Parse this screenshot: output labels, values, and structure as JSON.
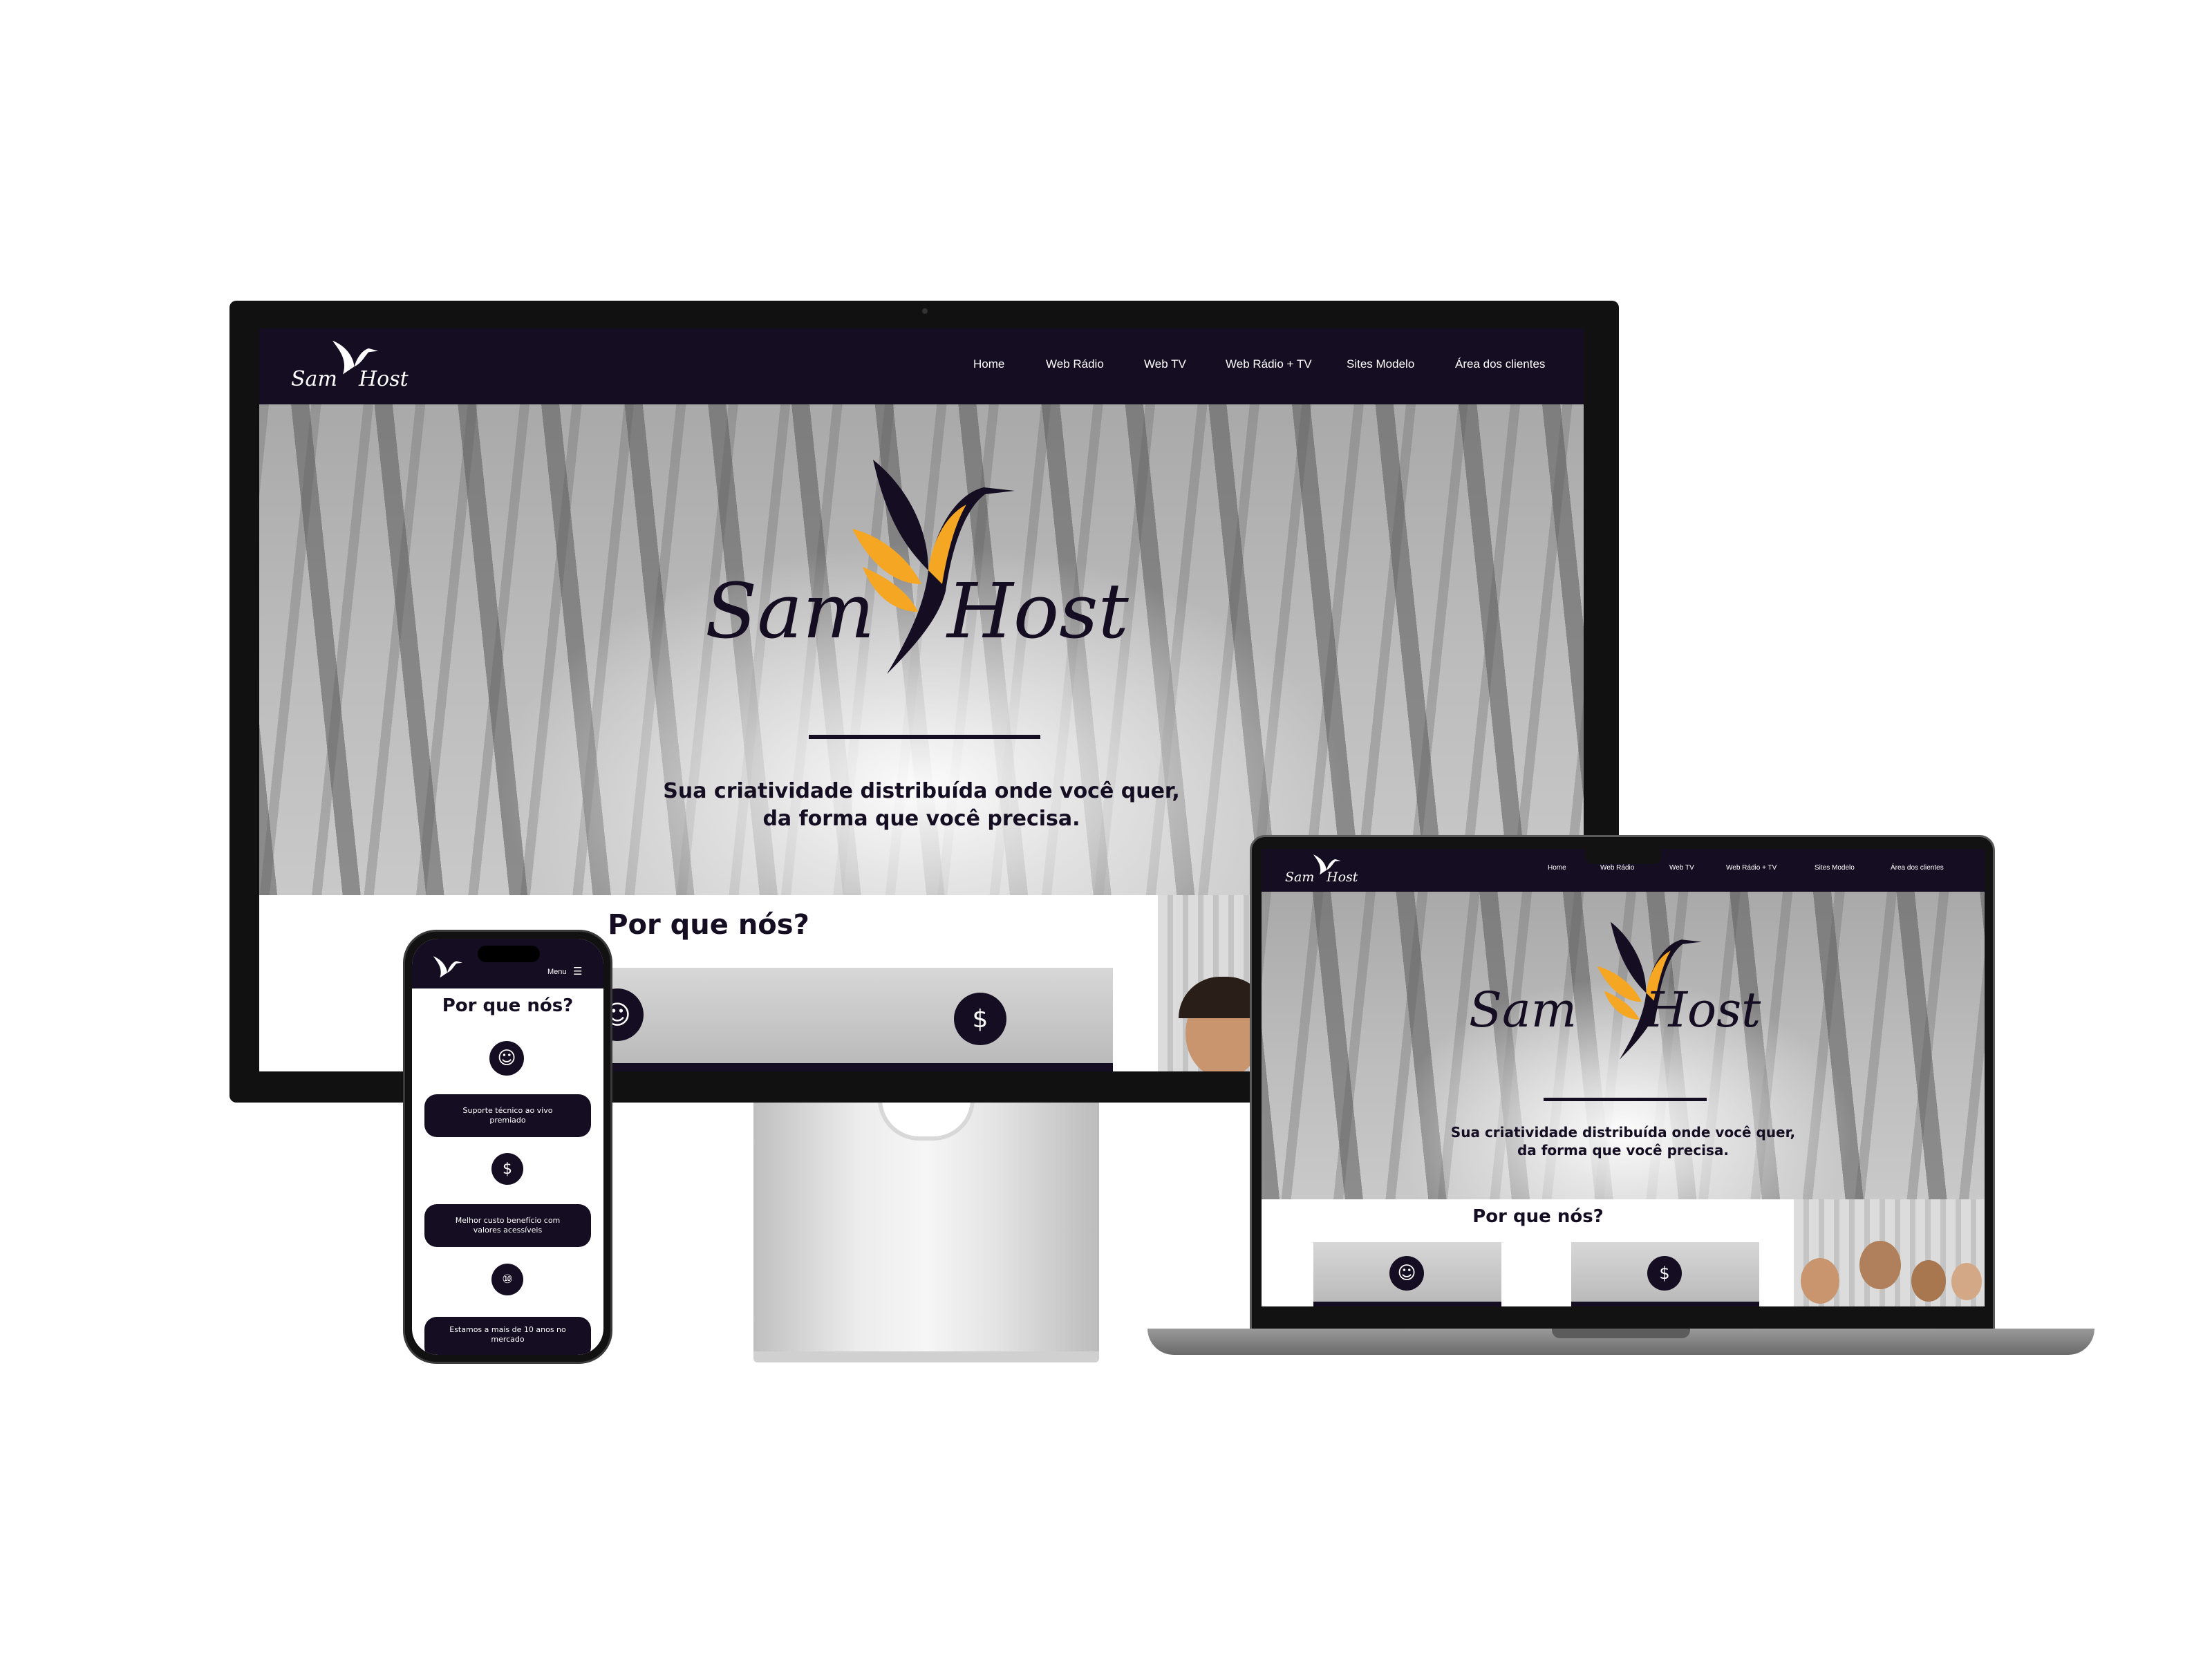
{
  "site": {
    "logo_word_1": "Sam",
    "logo_word_2": "Host",
    "nav": [
      "Home",
      "Web Rádio",
      "Web TV",
      "Web Rádio + TV",
      "Sites Modelo",
      "Área dos clientes"
    ],
    "tagline_line_1": "Sua criatividade distribuída onde você quer,",
    "tagline_line_2": "da forma que você precisa.",
    "section_title": "Por que nós?"
  },
  "mobile": {
    "menu_label": "Menu",
    "features": [
      {
        "icon": "support-agent-icon",
        "text": "Suporte técnico ao vivo premiado"
      },
      {
        "icon": "money-plant-icon",
        "text": "Melhor custo benefício com valores acessíveis"
      },
      {
        "icon": "ten-years-icon",
        "text": "Estamos a mais de 10 anos no mercado"
      }
    ]
  },
  "colors": {
    "brand_dark": "#150d22",
    "brand_accent": "#f5a623",
    "device_frame": "#111111"
  }
}
